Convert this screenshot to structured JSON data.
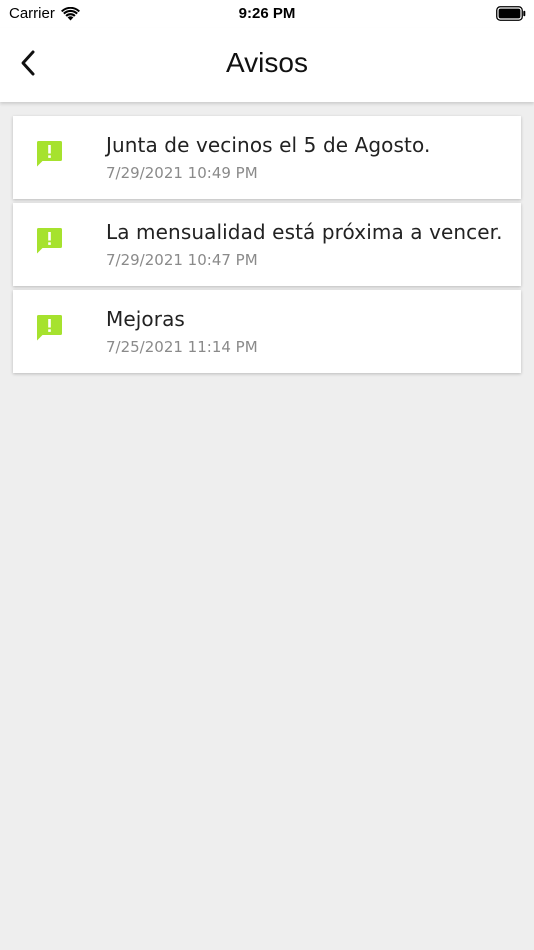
{
  "status_bar": {
    "carrier": "Carrier",
    "time": "9:26 PM"
  },
  "header": {
    "title": "Avisos"
  },
  "notices": [
    {
      "title": "Junta de vecinos el 5 de Agosto.",
      "date": "7/29/2021 10:49 PM"
    },
    {
      "title": "La mensualidad está próxima a vencer.",
      "date": "7/29/2021 10:47 PM"
    },
    {
      "title": "Mejoras",
      "date": "7/25/2021 11:14 PM"
    }
  ],
  "colors": {
    "accent": "#a6e22e",
    "background": "#eeeeee"
  }
}
